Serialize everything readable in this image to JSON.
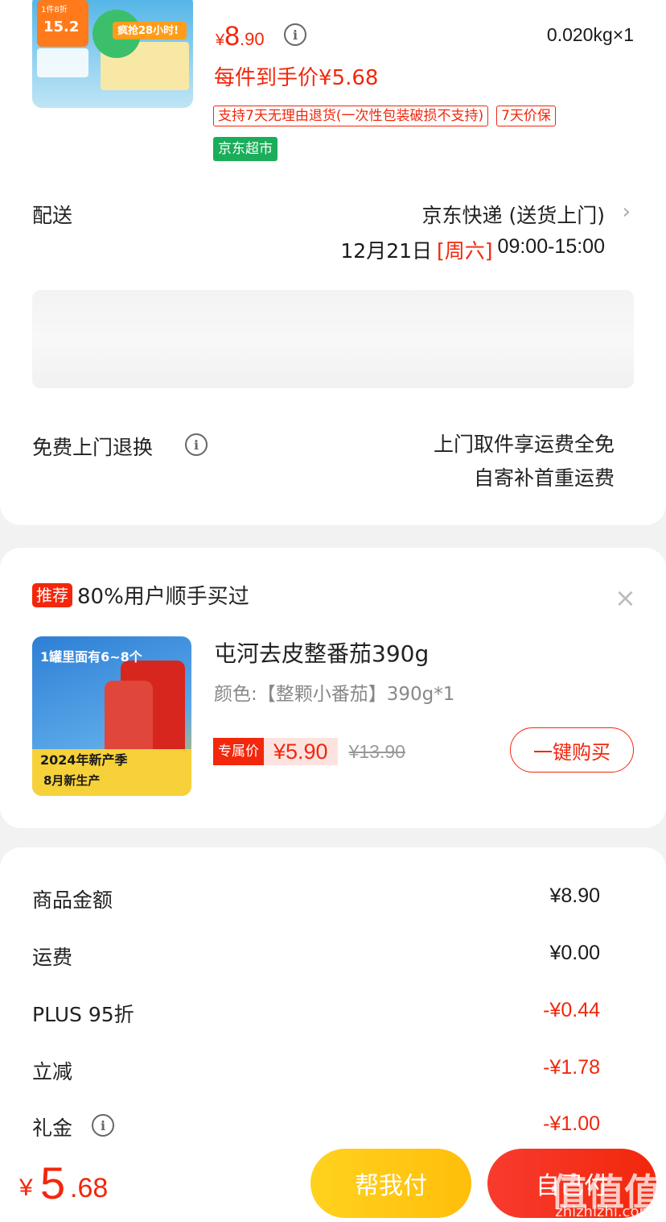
{
  "product": {
    "thumb_texts": {
      "promo": "1件8折",
      "price": "15.2",
      "slogan": "疯抢28小时!"
    },
    "currency": "¥",
    "price_int": "8",
    "price_dec": ".90",
    "quantity": "0.020kg×1",
    "final_price_text": "每件到手价¥5.68",
    "badges": [
      "支持7天无理由退货(一次性包装破损不支持)",
      "7天价保"
    ],
    "store_badge": "京东超市"
  },
  "delivery": {
    "label": "配送",
    "method": "京东快递 (送货上门)",
    "date": "12月21日",
    "weekday": "[周六]",
    "time": "09:00-15:00"
  },
  "return_service": {
    "label": "免费上门退换",
    "line1": "上门取件享运费全免",
    "line2": "自寄补首重运费"
  },
  "recommend": {
    "tag": "推荐",
    "title": "80%用户顺手买过",
    "thumb_texts": {
      "line1": "1罐里面有6~8个",
      "line2": "2024年新产季",
      "line3": "8月新生产"
    },
    "product_name": "屯河去皮整番茄390g",
    "variant": "颜色:【整颗小番茄】390g*1",
    "exclusive_tag": "专属价",
    "exclusive_price": "¥5.90",
    "original_price": "¥13.90",
    "buy_button": "一键购买"
  },
  "summary": {
    "rows": [
      {
        "label": "商品金额",
        "value": "¥8.90",
        "negative": false
      },
      {
        "label": "运费",
        "value": "¥0.00",
        "negative": false
      },
      {
        "label": "PLUS 95折",
        "value": "-¥0.44",
        "negative": true
      },
      {
        "label": "立减",
        "value": "-¥1.78",
        "negative": true
      },
      {
        "label": "礼金",
        "value": "-¥1.00",
        "negative": true
      }
    ]
  },
  "bottom_bar": {
    "total_currency": "¥",
    "total_int": "5",
    "total_dec": ".68",
    "pay_friend_label": "帮我付",
    "submit_label": "自己付",
    "watermark": "值值值",
    "watermark_url": "zhizhizhi.com"
  },
  "colors": {
    "accent": "#f2270c",
    "jd_green": "#1aad5a",
    "pay_friend": "#ffc21a"
  }
}
